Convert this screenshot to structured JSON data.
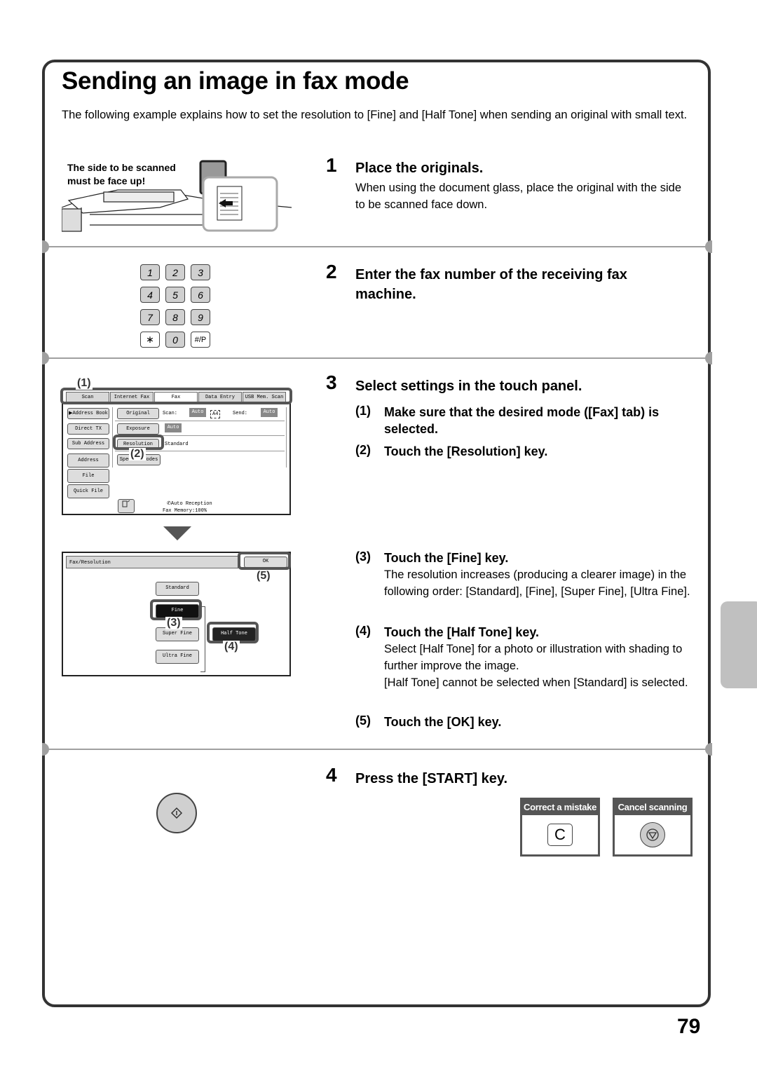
{
  "page": {
    "title": "Sending an image in fax mode",
    "intro": "The following example explains how to set the resolution to [Fine] and [Half Tone] when sending an original with small text.",
    "page_number": "79"
  },
  "illustration_scan": {
    "note_line1": "The side to be scanned",
    "note_line2": "must be face up!"
  },
  "keypad": {
    "keys": [
      "1",
      "2",
      "3",
      "4",
      "5",
      "6",
      "7",
      "8",
      "9",
      "∗",
      "0",
      "#/P"
    ]
  },
  "touch_panel": {
    "tabs": [
      "Scan",
      "Internet Fax",
      "Fax",
      "Data Entry",
      "USB Mem. Scan"
    ],
    "active_tab": "Fax",
    "left_buttons": [
      "▶Address Book",
      "Direct TX",
      "Sub Address",
      "Address Review",
      "File",
      "Quick File"
    ],
    "original_label": "Original",
    "scan_label": "Scan:",
    "scan_value": "Auto",
    "paper_size": "A4",
    "send_label": "Send:",
    "send_value": "Auto",
    "exposure_label": "Exposure",
    "exposure_value": "Auto",
    "resolution_label": "Resolution",
    "resolution_value": "Standard",
    "special_modes_label": "Special Modes",
    "status_line1": "Auto Reception",
    "status_line2": "Fax Memory:100%",
    "callout_1": "(1)",
    "callout_2": "(2)"
  },
  "resolution_panel": {
    "title": "Fax/Resolution",
    "ok_label": "OK",
    "options": [
      "Standard",
      "Fine",
      "Super Fine",
      "Ultra Fine"
    ],
    "selected": "Fine",
    "half_tone_label": "Half Tone",
    "callout_3": "(3)",
    "callout_4": "(4)",
    "callout_5": "(5)"
  },
  "steps": [
    {
      "number": "1",
      "heading": "Place the originals.",
      "body": "When using the document glass, place the original with the side to be scanned face down."
    },
    {
      "number": "2",
      "heading": "Enter the fax number of the receiving fax machine."
    },
    {
      "number": "3",
      "heading": "Select settings in the touch panel.",
      "substeps": [
        {
          "num": "(1)",
          "heading": "Make sure that the desired mode ([Fax] tab) is selected."
        },
        {
          "num": "(2)",
          "heading": "Touch the [Resolution] key."
        },
        {
          "num": "(3)",
          "heading": "Touch the [Fine] key.",
          "body": "The resolution increases (producing a clearer image) in the following order: [Standard], [Fine], [Super Fine], [Ultra Fine]."
        },
        {
          "num": "(4)",
          "heading": "Touch the [Half Tone] key.",
          "body": "Select [Half Tone] for a photo or illustration with shading to further improve the image.",
          "body2": "[Half Tone] cannot be selected when [Standard] is selected."
        },
        {
          "num": "(5)",
          "heading": "Touch the [OK] key."
        }
      ]
    },
    {
      "number": "4",
      "heading": "Press the [START] key."
    }
  ],
  "key_cards": [
    {
      "label": "Correct a mistake",
      "key": "C"
    },
    {
      "label": "Cancel scanning",
      "key": "stop"
    }
  ]
}
